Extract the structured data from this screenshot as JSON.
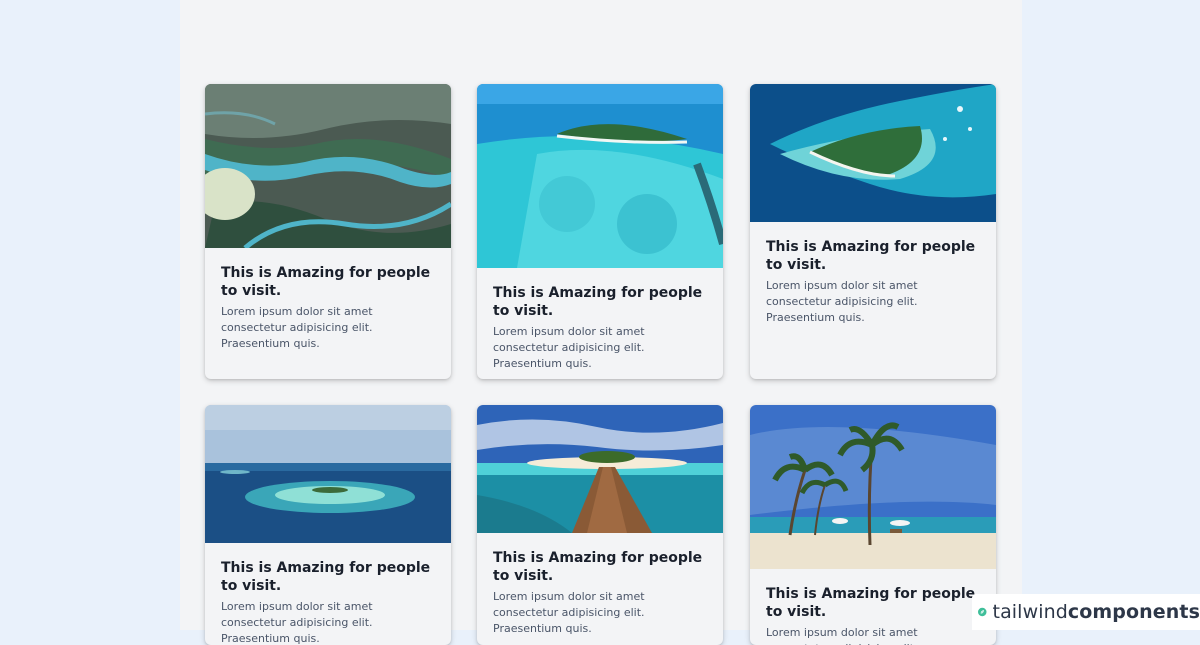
{
  "cards": [
    {
      "title": "This is Amazing for people to visit.",
      "text": "Lorem ipsum dolor sit amet consectetur adipisicing elit. Praesentium quis.",
      "image": "aerial-river-delta"
    },
    {
      "title": "This is Amazing for people to visit.",
      "text": "Lorem ipsum dolor sit amet consectetur adipisicing elit. Praesentium quis.",
      "image": "tropical-reef-island"
    },
    {
      "title": "This is Amazing for people to visit.",
      "text": "Lorem ipsum dolor sit amet consectetur adipisicing elit. Praesentium quis.",
      "image": "heart-shaped-island"
    },
    {
      "title": "This is Amazing for people to visit.",
      "text": "Lorem ipsum dolor sit amet consectetur adipisicing elit. Praesentium quis.",
      "image": "atoll-ocean-horizon"
    },
    {
      "title": "This is Amazing for people to visit.",
      "text": "Lorem ipsum dolor sit amet consectetur adipisicing elit. Praesentium quis.",
      "image": "wooden-pier-to-island"
    },
    {
      "title": "This is Amazing for people to visit.",
      "text": "Lorem ipsum dolor sit amet consectetur adipisicing elit. Praesentium quis.",
      "image": "palm-tree-beach"
    }
  ],
  "brand": {
    "light": "tailwind",
    "bold": "components",
    "icon": "leaf-icon"
  },
  "colors": {
    "page_bg": "#e9f1fb",
    "content_bg": "#f3f4f6",
    "title": "#1a202c",
    "text": "#4a5568"
  }
}
